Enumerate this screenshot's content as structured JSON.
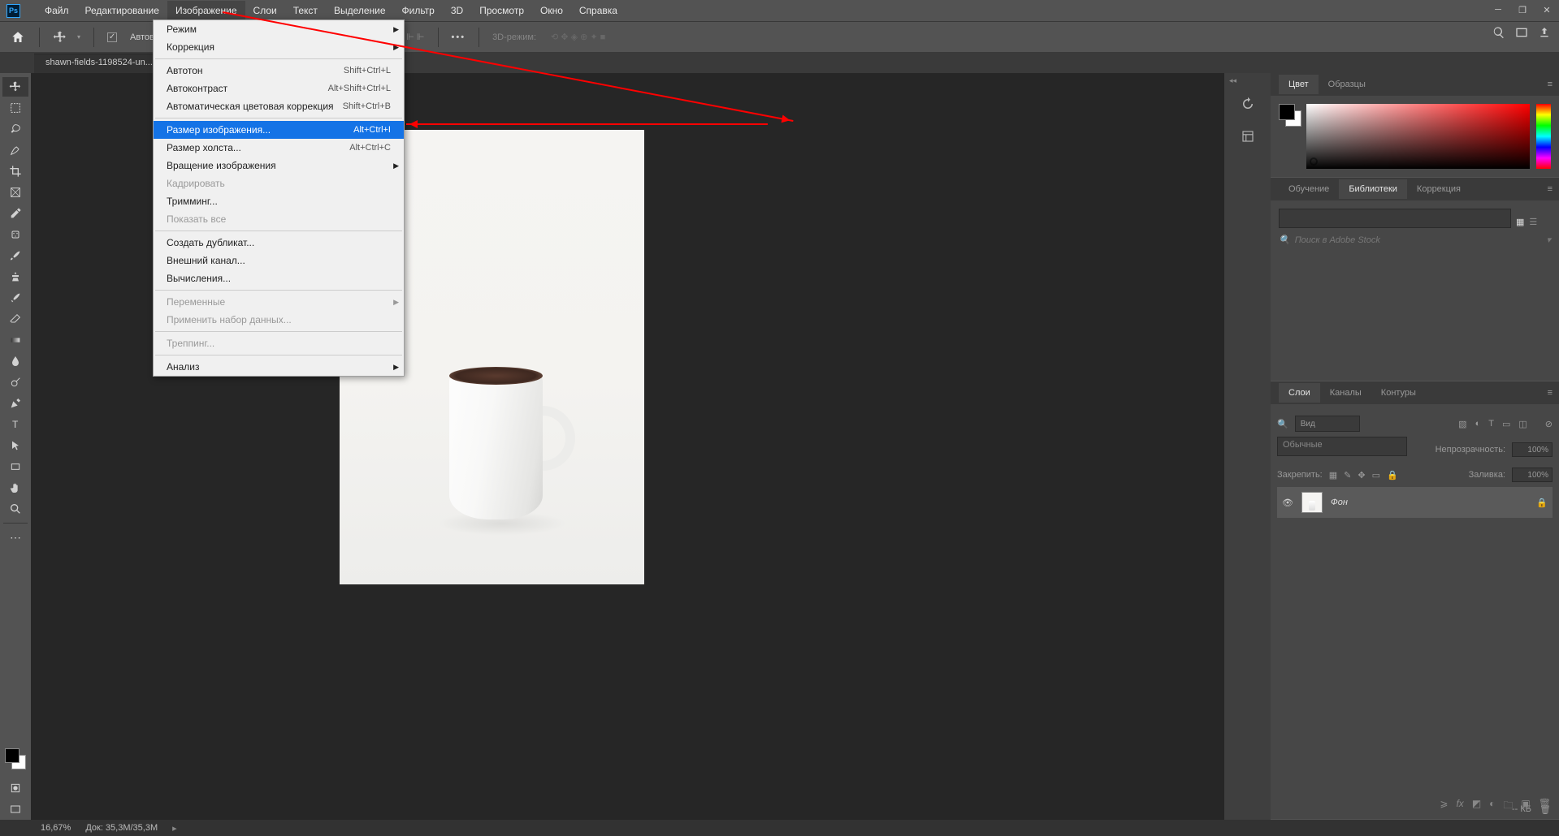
{
  "menubar": {
    "items": [
      "Файл",
      "Редактирование",
      "Изображение",
      "Слои",
      "Текст",
      "Выделение",
      "Фильтр",
      "3D",
      "Просмотр",
      "Окно",
      "Справка"
    ],
    "active_index": 2
  },
  "optionsbar": {
    "autoselect_label": "Автовыбор:",
    "mode_label": "3D-режим:"
  },
  "doc_tab": "shawn-fields-1198524-un...",
  "dropdown": {
    "items": [
      {
        "label": "Режим",
        "arrow": true
      },
      {
        "label": "Коррекция",
        "arrow": true
      },
      {
        "sep": true
      },
      {
        "label": "Автотон",
        "shortcut": "Shift+Ctrl+L"
      },
      {
        "label": "Автоконтраст",
        "shortcut": "Alt+Shift+Ctrl+L"
      },
      {
        "label": "Автоматическая цветовая коррекция",
        "shortcut": "Shift+Ctrl+B"
      },
      {
        "sep": true
      },
      {
        "label": "Размер изображения...",
        "shortcut": "Alt+Ctrl+I",
        "highlighted": true
      },
      {
        "label": "Размер холста...",
        "shortcut": "Alt+Ctrl+C"
      },
      {
        "label": "Вращение изображения",
        "arrow": true
      },
      {
        "label": "Кадрировать",
        "disabled": true
      },
      {
        "label": "Тримминг..."
      },
      {
        "label": "Показать все",
        "disabled": true
      },
      {
        "sep": true
      },
      {
        "label": "Создать дубликат..."
      },
      {
        "label": "Внешний канал..."
      },
      {
        "label": "Вычисления..."
      },
      {
        "sep": true
      },
      {
        "label": "Переменные",
        "arrow": true,
        "disabled": true
      },
      {
        "label": "Применить набор данных...",
        "disabled": true
      },
      {
        "sep": true
      },
      {
        "label": "Треппинг...",
        "disabled": true
      },
      {
        "sep": true
      },
      {
        "label": "Анализ",
        "arrow": true
      }
    ]
  },
  "panels": {
    "color": {
      "tabs": [
        "Цвет",
        "Образцы"
      ],
      "active": 0
    },
    "libraries": {
      "tabs": [
        "Обучение",
        "Библиотеки",
        "Коррекция"
      ],
      "active": 1,
      "search_placeholder": "Поиск в Adobe Stock",
      "kb_label": "-- КБ"
    },
    "layers": {
      "tabs": [
        "Слои",
        "Каналы",
        "Контуры"
      ],
      "active": 0,
      "search_label": "Вид",
      "blend_mode": "Обычные",
      "opacity_label": "Непрозрачность:",
      "opacity_value": "100%",
      "lock_label": "Закрепить:",
      "fill_label": "Заливка:",
      "fill_value": "100%",
      "layer_name": "Фон"
    }
  },
  "status": {
    "zoom": "16,67%",
    "doc": "Док: 35,3M/35,3M"
  }
}
